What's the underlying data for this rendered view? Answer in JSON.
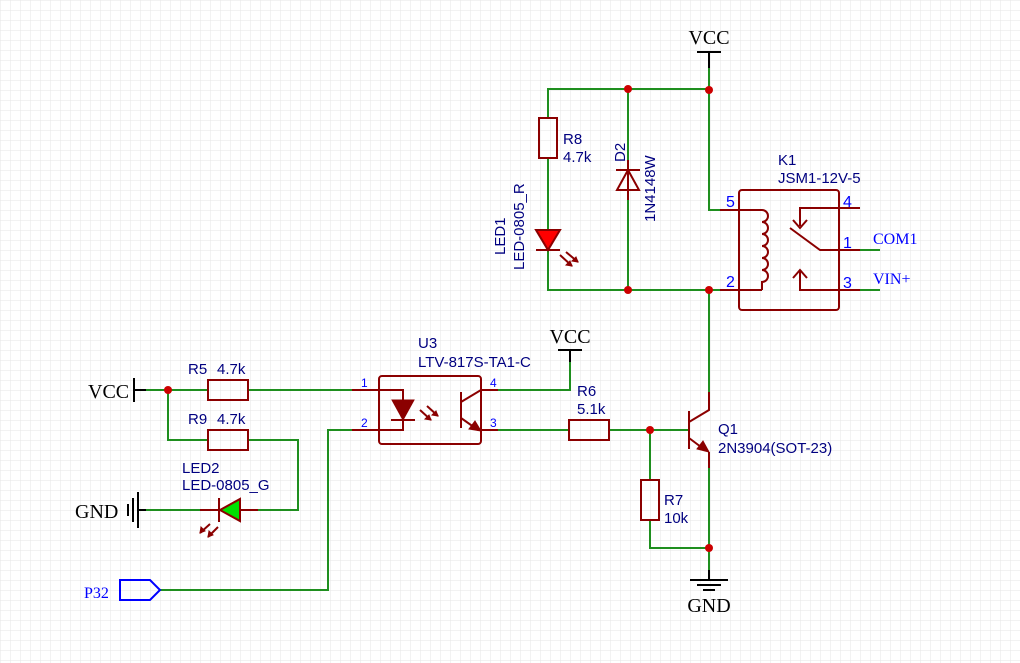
{
  "colors": {
    "wire": "#1f8f1f",
    "component": "#8b0000",
    "junction": "#cc0000",
    "designator": "#000080",
    "pin_number": "#0000ff",
    "net_port": "#0000ff"
  },
  "nets": {
    "vcc_top": "VCC",
    "vcc_opto": "VCC",
    "vcc_left": "VCC",
    "gnd_left": "GND",
    "gnd_bottom": "GND",
    "p32": "P32",
    "com1": "COM1",
    "vin": "VIN+"
  },
  "components": {
    "R8": {
      "ref": "R8",
      "value": "4.7k"
    },
    "D2": {
      "ref": "D2",
      "value": "1N4148W"
    },
    "LED1": {
      "ref": "LED1",
      "value": "LED-0805_R"
    },
    "K1": {
      "ref": "K1",
      "value": "JSM1-12V-5",
      "pins": [
        "5",
        "4",
        "1",
        "2",
        "3"
      ]
    },
    "U3": {
      "ref": "U3",
      "value": "LTV-817S-TA1-C",
      "pins": [
        "1",
        "2",
        "4",
        "3"
      ]
    },
    "R5": {
      "ref": "R5",
      "value": "4.7k"
    },
    "R9": {
      "ref": "R9",
      "value": "4.7k"
    },
    "LED2": {
      "ref": "LED2",
      "value": "LED-0805_G"
    },
    "R6": {
      "ref": "R6",
      "value": "5.1k"
    },
    "Q1": {
      "ref": "Q1",
      "value": "2N3904(SOT-23)"
    },
    "R7": {
      "ref": "R7",
      "value": "10k"
    }
  }
}
